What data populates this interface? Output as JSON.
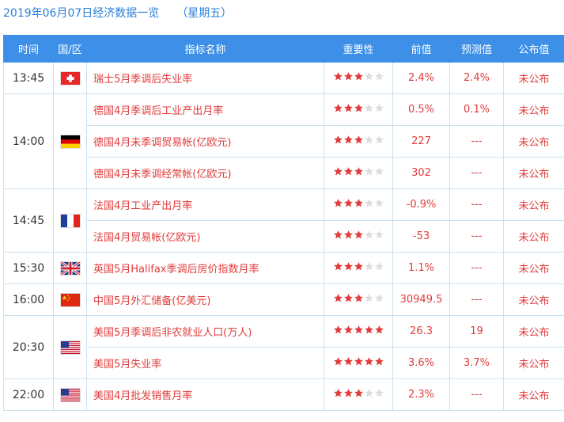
{
  "header": {
    "title": "2019年06月07日经济数据一览",
    "weekday": "（星期五）"
  },
  "table": {
    "columns": [
      "时间",
      "国/区",
      "指标名称",
      "重要性",
      "前值",
      "预测值",
      "公布值"
    ],
    "groups": [
      {
        "time": "13:45",
        "flag": "switzerland-flag-icon",
        "rows": [
          {
            "indicator": "瑞士5月季调后失业率",
            "stars": 3,
            "previous": "2.4%",
            "forecast": "2.4%",
            "actual": "未公布"
          }
        ]
      },
      {
        "time": "14:00",
        "flag": "germany-flag-icon",
        "rows": [
          {
            "indicator": "德国4月季调后工业产出月率",
            "stars": 3,
            "previous": "0.5%",
            "forecast": "0.1%",
            "actual": "未公布"
          },
          {
            "indicator": "德国4月未季调贸易帐(亿欧元)",
            "stars": 3,
            "previous": "227",
            "forecast": "---",
            "actual": "未公布"
          },
          {
            "indicator": "德国4月未季调经常帐(亿欧元)",
            "stars": 3,
            "previous": "302",
            "forecast": "---",
            "actual": "未公布"
          }
        ]
      },
      {
        "time": "14:45",
        "flag": "france-flag-icon",
        "rows": [
          {
            "indicator": "法国4月工业产出月率",
            "stars": 3,
            "previous": "-0.9%",
            "forecast": "---",
            "actual": "未公布"
          },
          {
            "indicator": "法国4月贸易帐(亿欧元)",
            "stars": 3,
            "previous": "-53",
            "forecast": "---",
            "actual": "未公布"
          }
        ]
      },
      {
        "time": "15:30",
        "flag": "uk-flag-icon",
        "rows": [
          {
            "indicator": "英国5月Halifax季调后房价指数月率",
            "stars": 3,
            "previous": "1.1%",
            "forecast": "---",
            "actual": "未公布"
          }
        ]
      },
      {
        "time": "16:00",
        "flag": "china-flag-icon",
        "rows": [
          {
            "indicator": "中国5月外汇储备(亿美元)",
            "stars": 3,
            "previous": "30949.5",
            "forecast": "---",
            "actual": "未公布"
          }
        ]
      },
      {
        "time": "20:30",
        "flag": "usa-flag-icon",
        "rows": [
          {
            "indicator": "美国5月季调后非农就业人口(万人)",
            "stars": 5,
            "previous": "26.3",
            "forecast": "19",
            "actual": "未公布"
          },
          {
            "indicator": "美国5月失业率",
            "stars": 5,
            "previous": "3.6%",
            "forecast": "3.7%",
            "actual": "未公布"
          }
        ]
      },
      {
        "time": "22:00",
        "flag": "usa-flag-icon",
        "rows": [
          {
            "indicator": "美国4月批发销售月率",
            "stars": 3,
            "previous": "2.3%",
            "forecast": "---",
            "actual": "未公布"
          }
        ]
      }
    ]
  },
  "colors": {
    "accent": "#3d8fe8",
    "title": "#2a7fd9",
    "value_text": "#e23b3b",
    "star_on": "#e23b3b",
    "star_off": "#dddddd",
    "border": "#cde1ef"
  }
}
